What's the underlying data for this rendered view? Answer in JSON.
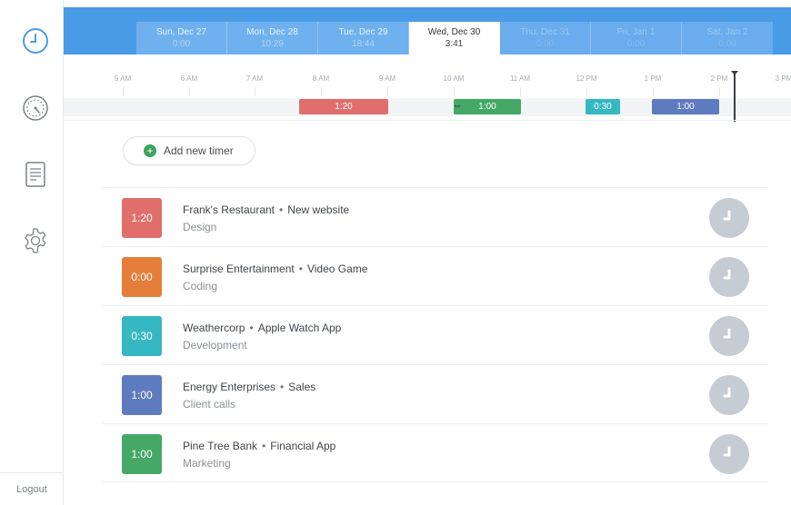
{
  "sidebar": {
    "items": [
      {
        "icon": "clock-icon"
      },
      {
        "icon": "dashboard-icon"
      },
      {
        "icon": "report-icon"
      },
      {
        "icon": "gear-icon"
      }
    ],
    "logout_label": "Logout"
  },
  "header": {
    "tabs": [
      {
        "day": "Sun, Dec 27",
        "total": "0:00"
      },
      {
        "day": "Mon, Dec 28",
        "total": "10:29"
      },
      {
        "day": "Tue, Dec 29",
        "total": "18:44"
      },
      {
        "day": "Wed, Dec 30",
        "total": "3:41"
      },
      {
        "day": "Thu, Dec 31",
        "total": "0:00"
      },
      {
        "day": "Fri, Jan 1",
        "total": "0:00"
      },
      {
        "day": "Sat, Jan 2",
        "total": "0:00"
      }
    ],
    "active_tab": "Wed, Dec 30"
  },
  "timeline": {
    "hours": [
      "5 AM",
      "6 AM",
      "7 AM",
      "8 AM",
      "9 AM",
      "10 AM",
      "11 AM",
      "12 PM",
      "1 PM",
      "2 PM",
      "3 PM"
    ],
    "bars": [
      {
        "label": "1:20",
        "color": "#e06f6c"
      },
      {
        "label": "1:00",
        "color": "#45a866"
      },
      {
        "label": "0:30",
        "color": "#36b8c2"
      },
      {
        "label": "1:00",
        "color": "#5f7bbf"
      }
    ]
  },
  "add_timer_label": "Add new timer",
  "timers": [
    {
      "duration": "1:20",
      "client": "Frank's Restaurant",
      "project": "New website",
      "task": "Design",
      "color": "#e06f6c"
    },
    {
      "duration": "0:00",
      "client": "Surprise Entertainment",
      "project": "Video Game",
      "task": "Coding",
      "color": "#e67e3b"
    },
    {
      "duration": "0:30",
      "client": "Weathercorp",
      "project": "Apple Watch App",
      "task": "Development",
      "color": "#36b8c2"
    },
    {
      "duration": "1:00",
      "client": "Energy Enterprises",
      "project": "Sales",
      "task": "Client calls",
      "color": "#5f7bbf"
    },
    {
      "duration": "1:00",
      "client": "Pine Tree Bank",
      "project": "Financial App",
      "task": "Marketing",
      "color": "#45a866"
    }
  ],
  "row_icon": "clock-icon",
  "colors": {
    "accent": "#4a9be6",
    "separator_dot": "•"
  }
}
